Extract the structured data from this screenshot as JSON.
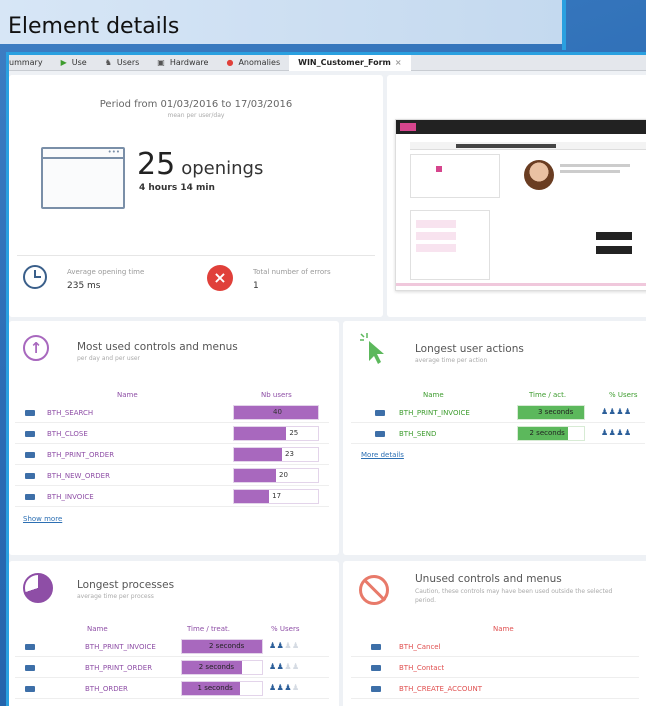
{
  "page": {
    "title": "Element details"
  },
  "tabs": [
    {
      "label": "ummary",
      "icon": "summary-icon"
    },
    {
      "label": "Use",
      "icon": "cursor-icon"
    },
    {
      "label": "Users",
      "icon": "user-icon"
    },
    {
      "label": "Hardware",
      "icon": "monitor-icon"
    },
    {
      "label": "Anomalies",
      "icon": "anomaly-icon"
    },
    {
      "label": "WIN_Customer_Form",
      "icon": "close-icon"
    }
  ],
  "period": {
    "title": "Period from 01/03/2016 to 17/03/2016",
    "subtitle": "mean per user/day",
    "openings_count": "25",
    "openings_label": "openings",
    "duration": "4 hours 14 min"
  },
  "metrics": {
    "avg_opening_label": "Average opening time",
    "avg_opening_value": "235 ms",
    "errors_label": "Total number of errors",
    "errors_value": "1"
  },
  "most_used": {
    "title": "Most used controls and menus",
    "subtitle": "per day and per user",
    "col_name": "Name",
    "col_users": "Nb users",
    "rows": [
      {
        "name": "BTH_SEARCH",
        "value": "40",
        "fill": 1.0
      },
      {
        "name": "BTH_CLOSE",
        "value": "25",
        "fill": 0.62
      },
      {
        "name": "BTH_PRINT_ORDER",
        "value": "23",
        "fill": 0.57
      },
      {
        "name": "BTH_NEW_ORDER",
        "value": "20",
        "fill": 0.5
      },
      {
        "name": "BTH_INVOICE",
        "value": "17",
        "fill": 0.42
      }
    ],
    "show_more": "Show more"
  },
  "longest_actions": {
    "title": "Longest user actions",
    "subtitle": "average time per action",
    "col_name": "Name",
    "col_time": "Time / act.",
    "col_users": "% Users",
    "rows": [
      {
        "name": "BTH_PRINT_INVOICE",
        "time": "3 seconds",
        "fill": 1.0,
        "users": 4
      },
      {
        "name": "BTH_SEND",
        "time": "2 seconds",
        "fill": 0.75,
        "users": 4
      }
    ],
    "more": "More details"
  },
  "longest_processes": {
    "title": "Longest processes",
    "subtitle": "average time per process",
    "col_name": "Name",
    "col_time": "Time / treat.",
    "col_users": "% Users",
    "rows": [
      {
        "name": "BTH_PRINT_INVOICE",
        "time": "2 seconds",
        "fill": 1.0,
        "users": 2
      },
      {
        "name": "BTH_PRINT_ORDER",
        "time": "2 seconds",
        "fill": 0.75,
        "users": 2
      },
      {
        "name": "BTH_ORDER",
        "time": "1 seconds",
        "fill": 0.72,
        "users": 3
      }
    ]
  },
  "unused": {
    "title": "Unused controls and menus",
    "caption": "Caution, these controls may have been used outside the selected period.",
    "col_name": "Name",
    "rows": [
      "BTH_Cancel",
      "BTH_Contact",
      "BTH_CREATE_ACCOUNT"
    ]
  },
  "colors": {
    "accent": "#2aa0e0",
    "purple": "#a868be",
    "green": "#5cb85c",
    "error": "#e0403a"
  }
}
